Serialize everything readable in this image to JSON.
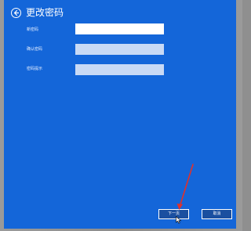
{
  "header": {
    "title": "更改密码",
    "back_icon": "back-arrow-circle-icon"
  },
  "form": {
    "fields": [
      {
        "label": "新密码",
        "value": ""
      },
      {
        "label": "确认密码",
        "value": ""
      },
      {
        "label": "密码提示",
        "value": ""
      }
    ]
  },
  "buttons": {
    "next_label": "下一页",
    "cancel_label": "取消"
  },
  "colors": {
    "panel_bg": "#1466d9",
    "annotation_arrow": "#e0312b"
  }
}
